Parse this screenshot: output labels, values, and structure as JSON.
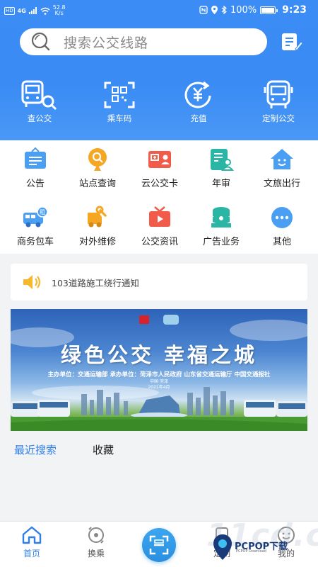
{
  "status_bar": {
    "network_hd": "HD",
    "network_type": "4G",
    "speed_value": "52.8",
    "speed_unit": "K/s",
    "battery": "100%",
    "time": "9:23"
  },
  "search": {
    "placeholder": "搜索公交线路"
  },
  "top_actions": [
    {
      "label": "查公交",
      "icon": "bus-search-icon"
    },
    {
      "label": "乘车码",
      "icon": "qr-code-icon"
    },
    {
      "label": "充值",
      "icon": "yuan-recharge-icon"
    },
    {
      "label": "定制公交",
      "icon": "custom-bus-icon"
    }
  ],
  "services": [
    {
      "label": "公告",
      "icon": "announcement-icon",
      "color": "#4a9ff2"
    },
    {
      "label": "站点查询",
      "icon": "station-search-icon",
      "color": "#f5a623"
    },
    {
      "label": "云公交卡",
      "icon": "cloud-bus-card-icon",
      "color": "#f25a4a"
    },
    {
      "label": "年审",
      "icon": "annual-review-icon",
      "color": "#2bb5a5"
    },
    {
      "label": "文旅出行",
      "icon": "tourism-house-icon",
      "color": "#4a9ff2"
    },
    {
      "label": "商务包车",
      "icon": "charter-bus-icon",
      "color": "#4a9ff2",
      "badge": "租"
    },
    {
      "label": "对外维修",
      "icon": "repair-icon",
      "color": "#f5a623"
    },
    {
      "label": "公交资讯",
      "icon": "news-tv-icon",
      "color": "#f25a4a"
    },
    {
      "label": "广告业务",
      "icon": "advertising-icon",
      "color": "#2bb5a5"
    },
    {
      "label": "其他",
      "icon": "more-icon",
      "color": "#4a9ff2"
    }
  ],
  "notice": {
    "text": "103道路施工绕行通知"
  },
  "banner": {
    "title": "绿色公交 幸福之城",
    "subtitle": "主办单位：交通运输部  承办单位：菏泽市人民政府  山东省交通运输厅  中国交通报社",
    "place": "中国·菏泽",
    "date": "2021年4月"
  },
  "tabs": {
    "recent": "最近搜索",
    "favorites": "收藏"
  },
  "bottom_nav": [
    {
      "label": "首页",
      "icon": "home-icon",
      "active": true
    },
    {
      "label": "换乘",
      "icon": "transfer-icon",
      "active": false
    },
    {
      "label": "定制",
      "icon": "custom-icon",
      "active": false
    },
    {
      "label": "我的",
      "icon": "profile-icon",
      "active": false
    }
  ],
  "watermark": {
    "text": "11cd.com",
    "brand": "PCPOP下载",
    "sub": "PCPOP Download"
  },
  "colors": {
    "primary": "#3a8cf4",
    "active_tab": "#2f7fe6"
  }
}
